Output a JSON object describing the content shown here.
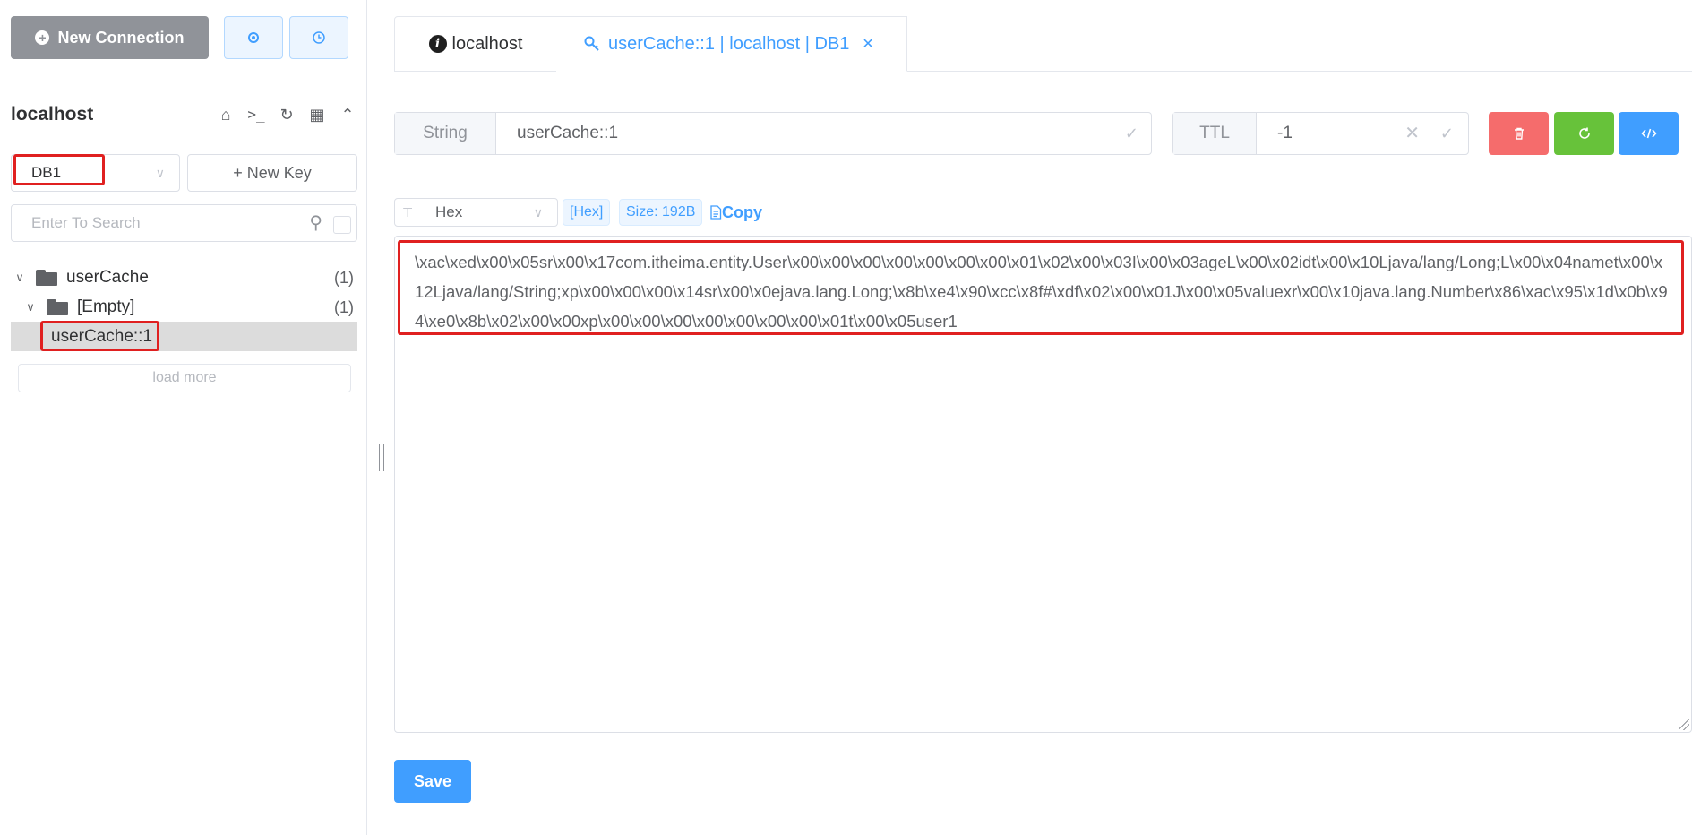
{
  "sidebar": {
    "new_connection_label": "New Connection",
    "connection_name": "localhost",
    "db_selected": "DB1",
    "new_key_label": "+ New Key",
    "search_placeholder": "Enter To Search",
    "tree": [
      {
        "label": "userCache",
        "count": "(1)"
      },
      {
        "label": "[Empty]",
        "count": "(1)"
      },
      {
        "label": "userCache::1"
      }
    ],
    "load_more_label": "load more"
  },
  "tabs": [
    {
      "label": "localhost"
    },
    {
      "label": "userCache::1 | localhost | DB1"
    }
  ],
  "key": {
    "type_label": "String",
    "name": "userCache::1",
    "ttl_label": "TTL",
    "ttl_value": "-1"
  },
  "viewer": {
    "format": "Hex",
    "format_tag": "[Hex]",
    "size_tag": "Size: 192B",
    "copy_label": "Copy",
    "value": "\\xac\\xed\\x00\\x05sr\\x00\\x17com.itheima.entity.User\\x00\\x00\\x00\\x00\\x00\\x00\\x00\\x01\\x02\\x00\\x03I\\x00\\x03ageL\\x00\\x02idt\\x00\\x10Ljava/lang/Long;L\\x00\\x04namet\\x00\\x12Ljava/lang/String;xp\\x00\\x00\\x00\\x14sr\\x00\\x0ejava.lang.Long;\\x8b\\xe4\\x90\\xcc\\x8f#\\xdf\\x02\\x00\\x01J\\x00\\x05valuexr\\x00\\x10java.lang.Number\\x86\\xac\\x95\\x1d\\x0b\\x94\\xe0\\x8b\\x02\\x00\\x00xp\\x00\\x00\\x00\\x00\\x00\\x00\\x00\\x01t\\x00\\x05user1",
    "save_label": "Save"
  },
  "colors": {
    "primary": "#409eff",
    "danger": "#f56c6c",
    "success": "#67c23a",
    "highlight_box": "#e02020"
  }
}
